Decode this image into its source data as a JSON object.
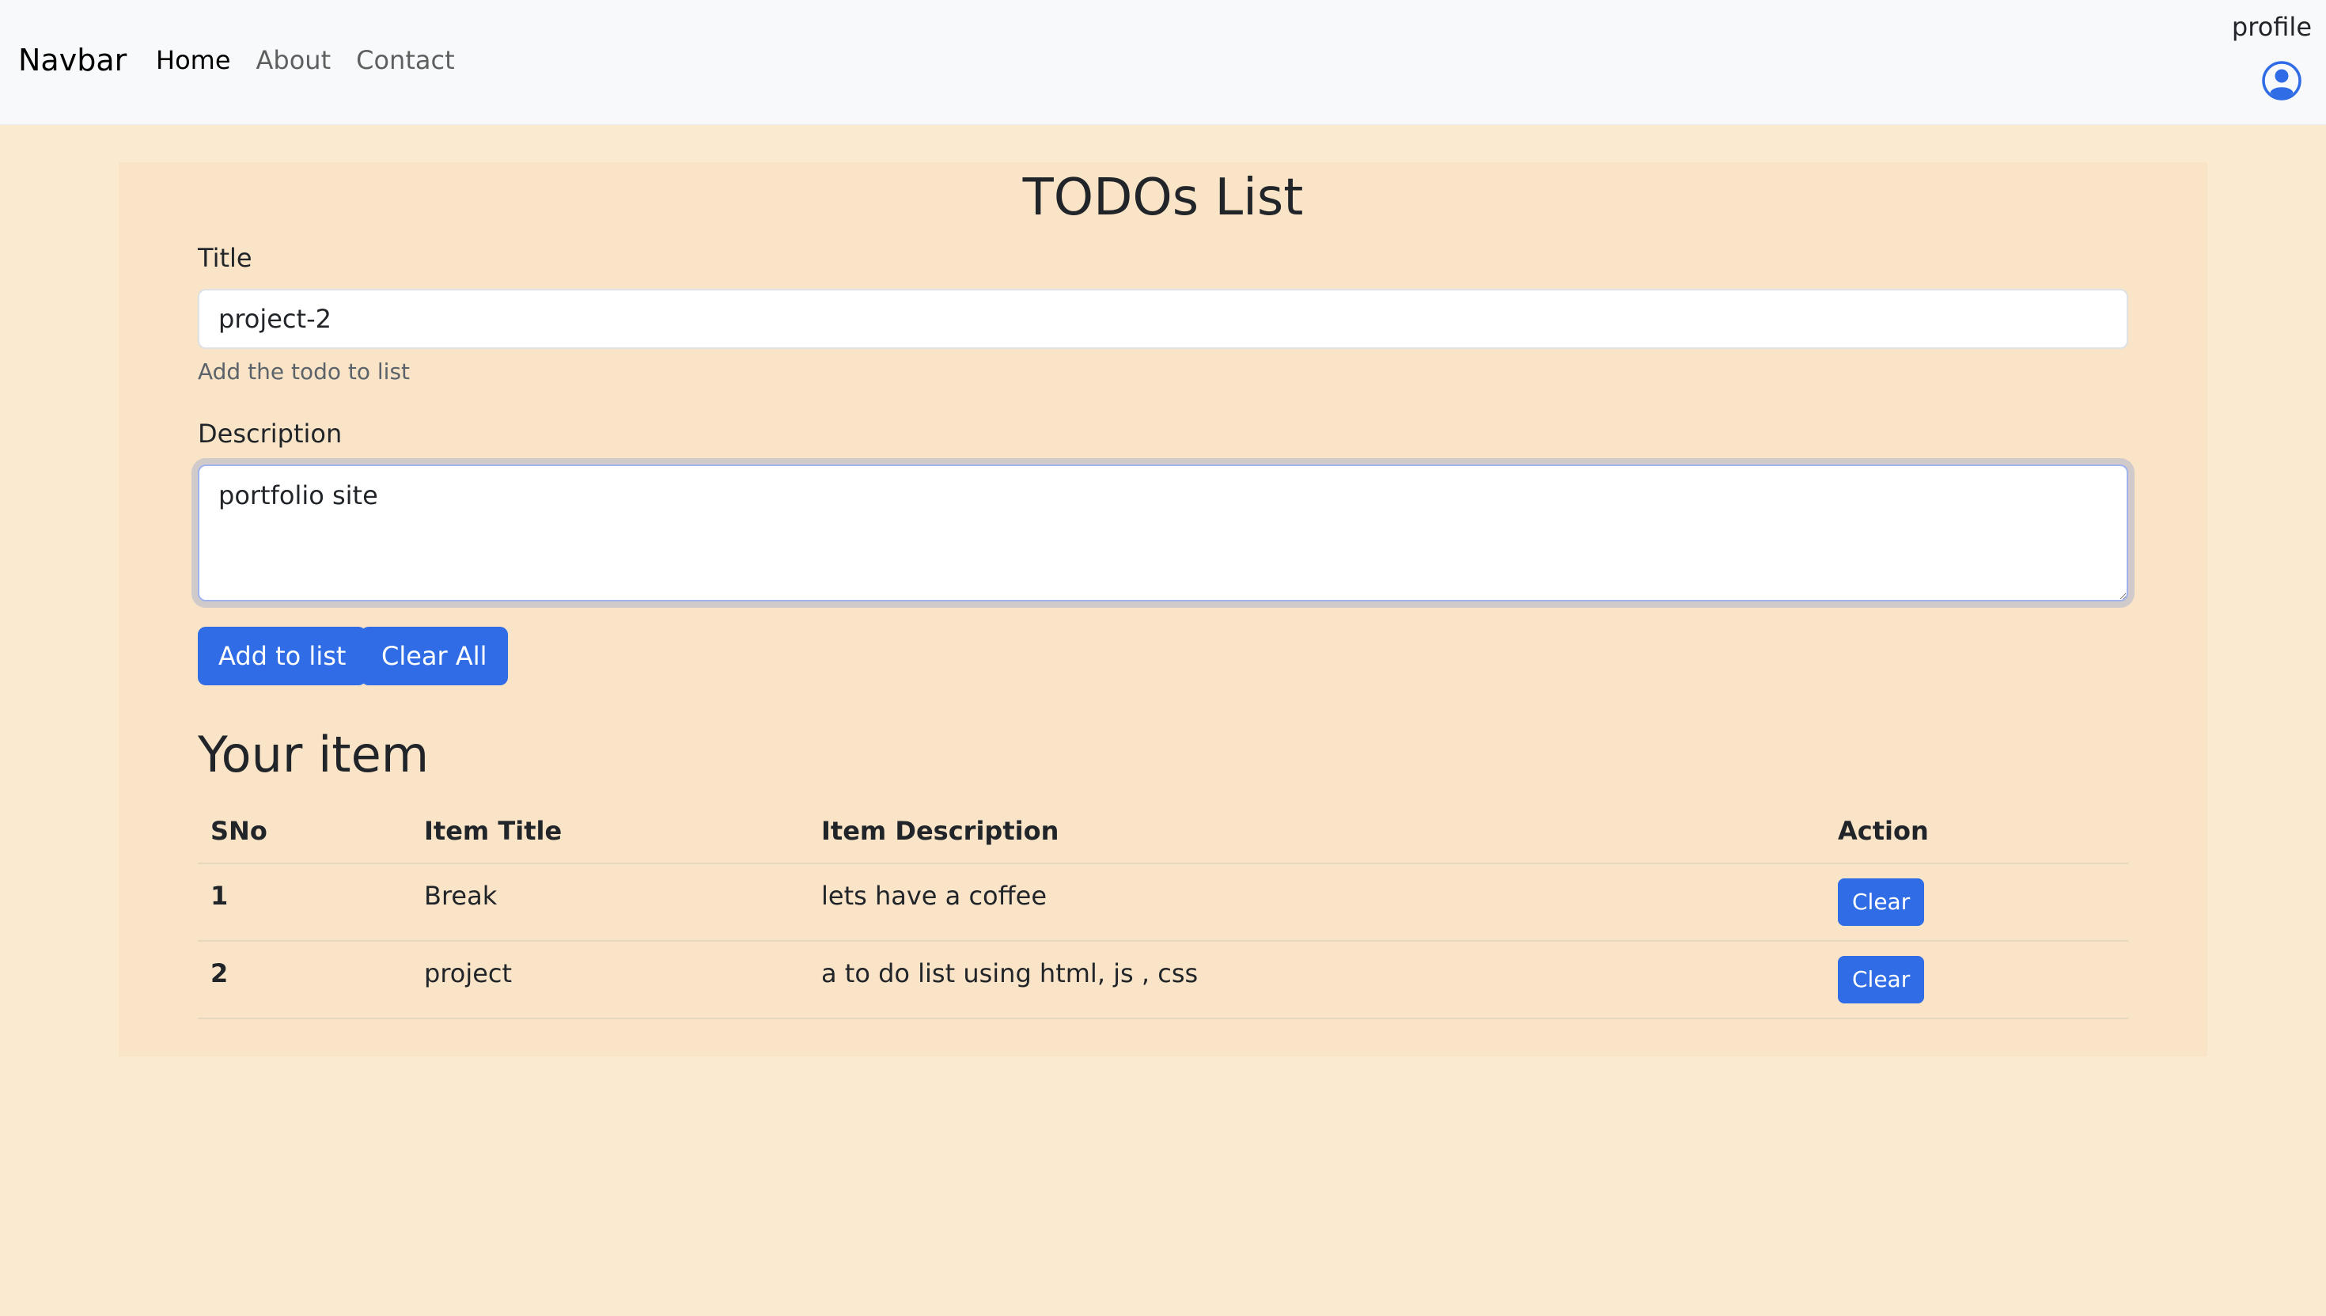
{
  "navbar": {
    "brand": "Navbar",
    "links": [
      {
        "label": "Home",
        "active": true
      },
      {
        "label": "About",
        "active": false
      },
      {
        "label": "Contact",
        "active": false
      }
    ],
    "profile_label": "profile",
    "profile_icon": "user-circle-icon"
  },
  "form": {
    "heading": "TODOs List",
    "title_label": "Title",
    "title_value": "project-2",
    "title_help": "Add the todo to list",
    "description_label": "Description",
    "description_value": "portfolio site",
    "add_button": "Add to list",
    "clear_all_button": "Clear All"
  },
  "list": {
    "heading": "Your item",
    "columns": [
      "SNo",
      "Item Title",
      "Item Description",
      "Action"
    ],
    "rows": [
      {
        "sno": "1",
        "title": "Break",
        "description": "lets have a coffee",
        "action": "Clear"
      },
      {
        "sno": "2",
        "title": "project",
        "description": "a to do list using html, js , css",
        "action": "Clear"
      }
    ]
  },
  "colors": {
    "page_background": "#faebd0",
    "card_background": "#f9e4c7",
    "primary": "#2f6ce5",
    "navbar_background": "#f8f9fa"
  }
}
